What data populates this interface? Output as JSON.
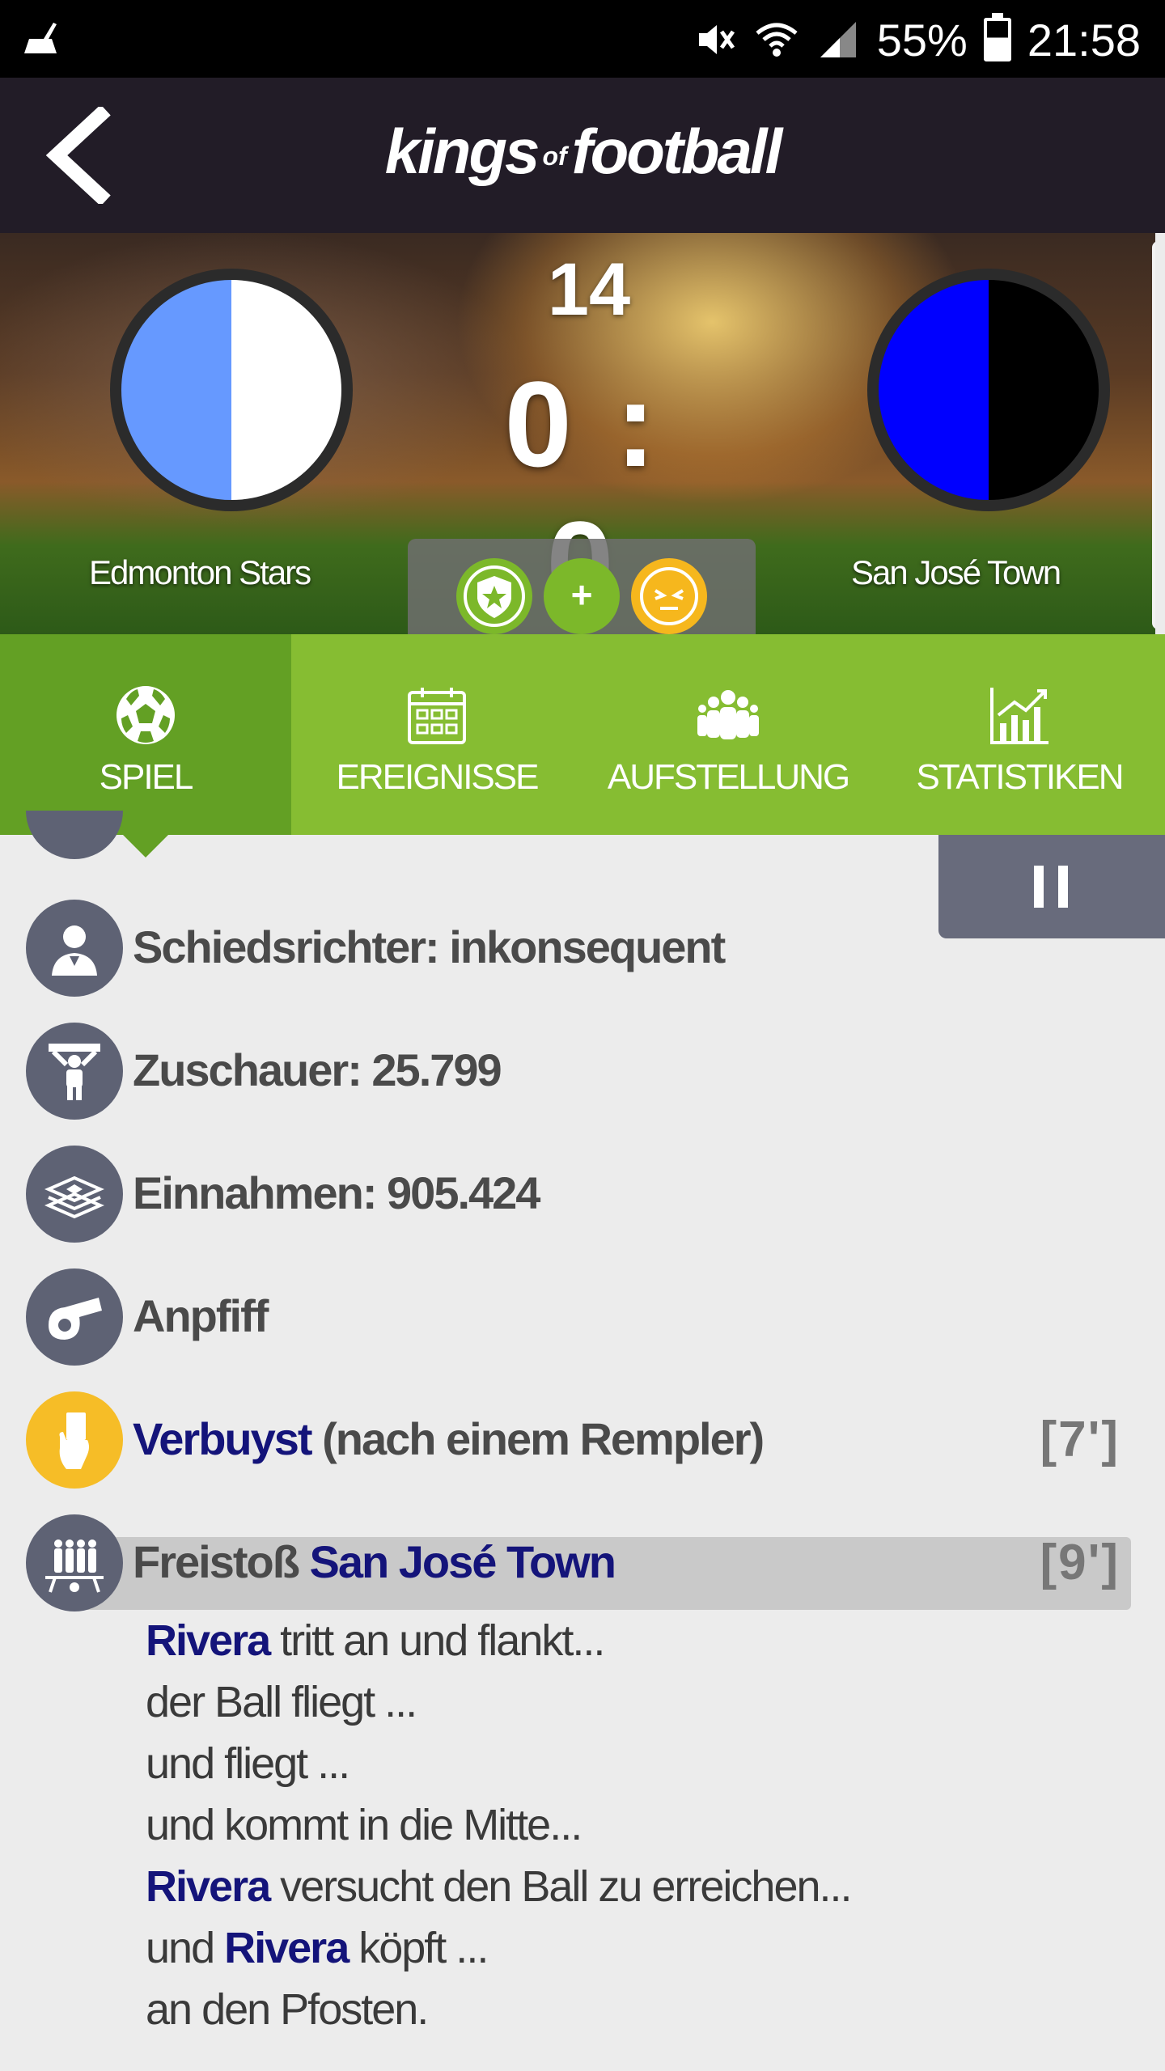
{
  "status_bar": {
    "battery": "55%",
    "time": "21:58"
  },
  "app": {
    "brand_left": "kings",
    "brand_of": "of",
    "brand_right": "football"
  },
  "match": {
    "home_team": "Edmonton Stars",
    "away_team": "San José Town",
    "minute": "14",
    "score": "0 : 0",
    "home_colors": [
      "#6699ff",
      "#ffffff"
    ],
    "away_colors": [
      "#0000ff",
      "#000000"
    ],
    "actions": {
      "plus_label": "+"
    }
  },
  "tabs": [
    {
      "label": "SPIEL",
      "icon": "soccer-ball-icon"
    },
    {
      "label": "EREIGNISSE",
      "icon": "calendar-icon"
    },
    {
      "label": "AUFSTELLUNG",
      "icon": "team-icon"
    },
    {
      "label": "STATISTIKEN",
      "icon": "chart-icon"
    }
  ],
  "feed": {
    "items": [
      {
        "icon": "referee-icon",
        "text": "Schiedsrichter: inkonsequent"
      },
      {
        "icon": "spectator-icon",
        "text": "Zuschauer: 25.799"
      },
      {
        "icon": "money-icon",
        "text": "Einnahmen: 905.424"
      },
      {
        "icon": "whistle-icon",
        "text": "Anpfiff"
      },
      {
        "icon": "yellow-card-icon",
        "player": "Verbuyst",
        "text": "(nach einem Rempler)",
        "minute": "[7']"
      },
      {
        "icon": "free-kick-icon",
        "prefix": "Freistoß",
        "team": "San José Town",
        "minute": "[9']"
      }
    ],
    "commentary": [
      {
        "player": "Rivera",
        "text": " tritt an und flankt..."
      },
      {
        "text": "der Ball fliegt ..."
      },
      {
        "text": "und fliegt ..."
      },
      {
        "text": "und kommt in die Mitte..."
      },
      {
        "player": "Rivera",
        "text": " versucht den Ball zu erreichen..."
      },
      {
        "prefix": "und ",
        "player": "Rivera",
        "text": " köpft ..."
      },
      {
        "text": "an den Pfosten."
      }
    ]
  },
  "colors": {
    "header_bg": "#221c27",
    "tab_green": "#86bd32",
    "tab_active": "#63a024",
    "icon_gray": "#5e6274",
    "yellow": "#f6bd27",
    "team_blue_text": "#14147a"
  }
}
